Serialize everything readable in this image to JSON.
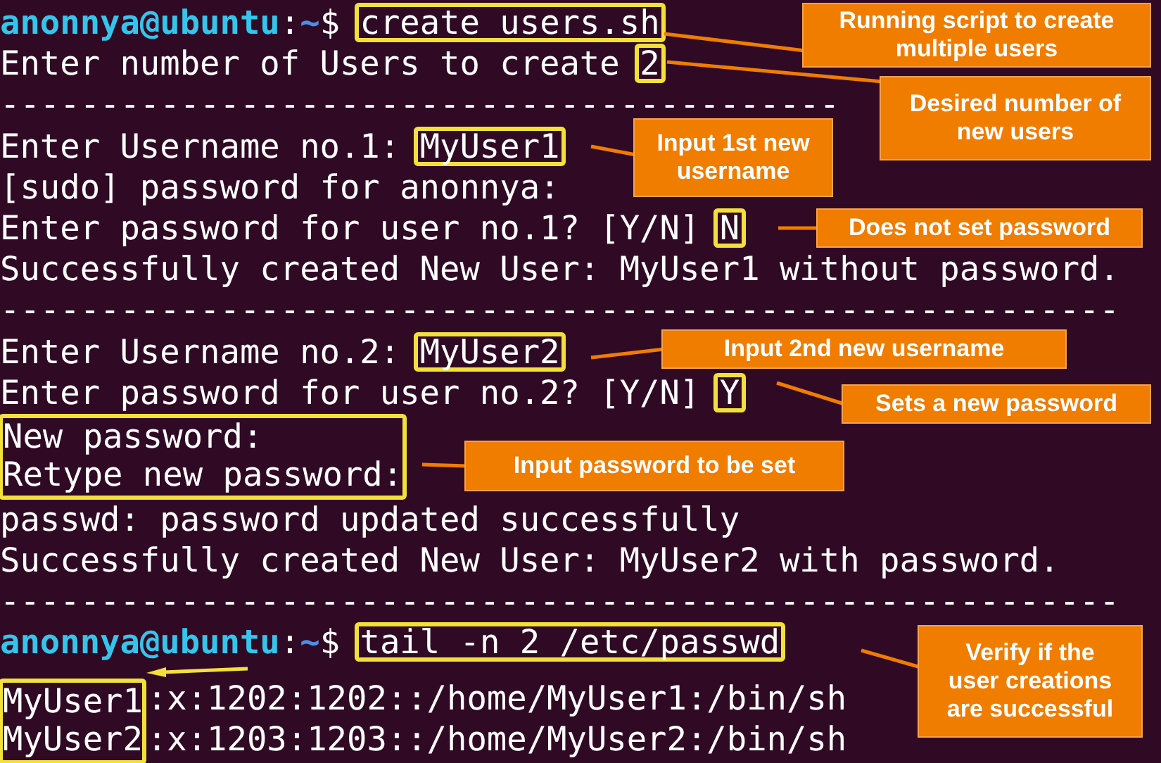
{
  "terminal": {
    "blocks": [
      {
        "kind": "line",
        "segments": [
          {
            "kind": "user",
            "text": "anonnya@ubuntu"
          },
          {
            "kind": "plain",
            "text": ":"
          },
          {
            "kind": "path",
            "text": "~"
          },
          {
            "kind": "plain",
            "text": "$ "
          },
          {
            "kind": "boxed",
            "text": "create users.sh"
          }
        ]
      },
      {
        "kind": "line",
        "segments": [
          {
            "kind": "plain",
            "text": "Enter number of Users to create "
          },
          {
            "kind": "boxed",
            "text": "2"
          }
        ]
      },
      {
        "kind": "line",
        "segments": [
          {
            "kind": "plain",
            "text": "------------------------------------------"
          }
        ]
      },
      {
        "kind": "line",
        "segments": [
          {
            "kind": "plain",
            "text": "Enter Username no.1: "
          },
          {
            "kind": "boxed",
            "text": "MyUser1"
          }
        ]
      },
      {
        "kind": "line",
        "segments": [
          {
            "kind": "plain",
            "text": "[sudo] password for anonnya:"
          }
        ]
      },
      {
        "kind": "line",
        "segments": [
          {
            "kind": "plain",
            "text": "Enter password for user no.1? [Y/N] "
          },
          {
            "kind": "boxed",
            "text": "N"
          }
        ]
      },
      {
        "kind": "line",
        "segments": [
          {
            "kind": "plain",
            "text": "Successfully created New User: MyUser1 without password."
          }
        ]
      },
      {
        "kind": "line",
        "segments": [
          {
            "kind": "plain",
            "text": "--------------------------------------------------------"
          }
        ]
      },
      {
        "kind": "line",
        "segments": [
          {
            "kind": "plain",
            "text": "Enter Username no.2: "
          },
          {
            "kind": "boxed",
            "text": "MyUser2"
          }
        ]
      },
      {
        "kind": "line",
        "segments": [
          {
            "kind": "plain",
            "text": "Enter password for user no.2? [Y/N] "
          },
          {
            "kind": "boxed",
            "text": "Y"
          }
        ]
      },
      {
        "kind": "boxed_lines",
        "lines": [
          "New password:",
          "Retype new password:"
        ]
      },
      {
        "kind": "line",
        "segments": [
          {
            "kind": "plain",
            "text": "passwd: password updated successfully"
          }
        ]
      },
      {
        "kind": "line",
        "segments": [
          {
            "kind": "plain",
            "text": "Successfully created New User: MyUser2 with password."
          }
        ]
      },
      {
        "kind": "line",
        "segments": [
          {
            "kind": "plain",
            "text": "--------------------------------------------------------"
          }
        ]
      },
      {
        "kind": "line",
        "segments": [
          {
            "kind": "user",
            "text": "anonnya@ubuntu"
          },
          {
            "kind": "plain",
            "text": ":"
          },
          {
            "kind": "path",
            "text": "~"
          },
          {
            "kind": "plain",
            "text": "$ "
          },
          {
            "kind": "boxed",
            "text": "tail -n 2 /etc/passwd"
          }
        ]
      },
      {
        "kind": "split",
        "boxed": [
          "MyUser1",
          "MyUser2"
        ],
        "rest": [
          ":x:1202:1202::/home/MyUser1:/bin/sh",
          ":x:1203:1203::/home/MyUser2:/bin/sh"
        ]
      }
    ]
  },
  "callouts": [
    {
      "text": "Running script to create multiple users"
    },
    {
      "text": "Desired number of new users"
    },
    {
      "text": "Input 1st new username"
    },
    {
      "text": "Does not set password"
    },
    {
      "text": "Input 2nd new username"
    },
    {
      "text": "Sets a new password"
    },
    {
      "text": "Input password to be set"
    },
    {
      "text": "Verify if the user creations are successful"
    }
  ]
}
